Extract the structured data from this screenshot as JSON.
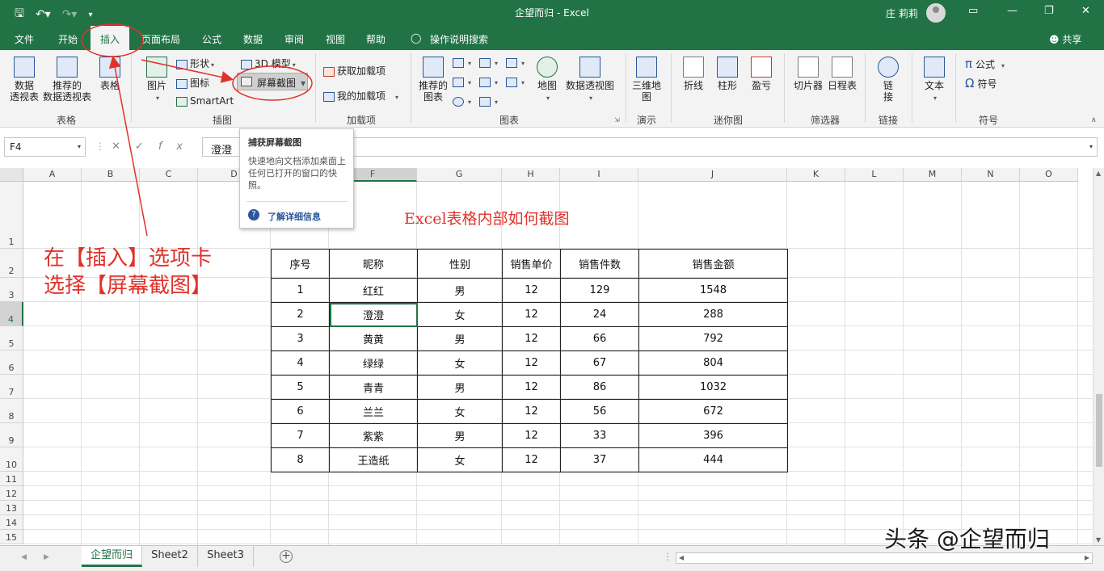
{
  "window": {
    "title": "企望而归  -  Excel",
    "user": "庄 莉莉"
  },
  "tabs": [
    {
      "label": "文件"
    },
    {
      "label": "开始"
    },
    {
      "label": "插入"
    },
    {
      "label": "页面布局"
    },
    {
      "label": "公式"
    },
    {
      "label": "数据"
    },
    {
      "label": "审阅"
    },
    {
      "label": "视图"
    },
    {
      "label": "帮助"
    },
    {
      "label": "操作说明搜索"
    }
  ],
  "share_label": "共享",
  "ribbon": {
    "tables": {
      "pivot": "数据\n透视表",
      "recommended_pivot": "推荐的\n数据透视表",
      "table": "表格",
      "group": "表格"
    },
    "illustrations": {
      "pictures": "图片",
      "shapes": "形状",
      "icons": "图标",
      "model3d": "3D 模型",
      "smartart": "SmartArt",
      "screenshot": "屏幕截图",
      "group": "插图"
    },
    "addins": {
      "get": "获取加载项",
      "my": "我的加载项",
      "group": "加载项"
    },
    "charts": {
      "recommended": "推荐的\n图表",
      "maps": "地图",
      "pivotchart": "数据透视图",
      "group": "图表"
    },
    "tours": {
      "map3d": "三维地\n图",
      "group": "演示"
    },
    "sparklines": {
      "line": "折线",
      "column": "柱形",
      "winloss": "盈亏",
      "group": "迷你图"
    },
    "filters": {
      "slicer": "切片器",
      "timeline": "日程表",
      "group": "筛选器"
    },
    "links": {
      "link": "链\n接",
      "group": "链接"
    },
    "text": {
      "text": "文本"
    },
    "symbols": {
      "equation": "公式",
      "symbol": "符号",
      "group": "符号"
    }
  },
  "tooltip": {
    "title": "捕获屏幕截图",
    "desc": "快速地向文档添加桌面上任何已打开的窗口的快照。",
    "link": "了解详细信息"
  },
  "formula_bar": {
    "namebox": "F4",
    "fx": "fx",
    "value": "澄澄"
  },
  "columns": [
    "A",
    "B",
    "C",
    "D",
    "E",
    "F",
    "G",
    "H",
    "I",
    "J",
    "K",
    "L",
    "M",
    "N",
    "O"
  ],
  "rows": [
    "1",
    "2",
    "3",
    "4",
    "5",
    "6",
    "7",
    "8",
    "9",
    "10",
    "11",
    "12",
    "13",
    "14",
    "15"
  ],
  "sheet_title": "Excel表格内部如何截图",
  "table": {
    "headers": [
      "序号",
      "昵称",
      "性别",
      "销售单价",
      "销售件数",
      "销售金额"
    ],
    "rows": [
      [
        "1",
        "红红",
        "男",
        "12",
        "129",
        "1548"
      ],
      [
        "2",
        "澄澄",
        "女",
        "12",
        "24",
        "288"
      ],
      [
        "3",
        "黄黄",
        "男",
        "12",
        "66",
        "792"
      ],
      [
        "4",
        "绿绿",
        "女",
        "12",
        "67",
        "804"
      ],
      [
        "5",
        "青青",
        "男",
        "12",
        "86",
        "1032"
      ],
      [
        "6",
        "兰兰",
        "女",
        "12",
        "56",
        "672"
      ],
      [
        "7",
        "紫紫",
        "男",
        "12",
        "33",
        "396"
      ],
      [
        "8",
        "王造纸",
        "女",
        "12",
        "37",
        "444"
      ]
    ]
  },
  "annotation": {
    "line1": "在【插入】选项卡",
    "line2": "选择【屏幕截图】"
  },
  "sheets": [
    "企望而归",
    "Sheet2",
    "Sheet3"
  ],
  "watermark": "头条 @企望而归",
  "colors": {
    "excel_green": "#217346",
    "annotation_red": "#e0322b"
  }
}
